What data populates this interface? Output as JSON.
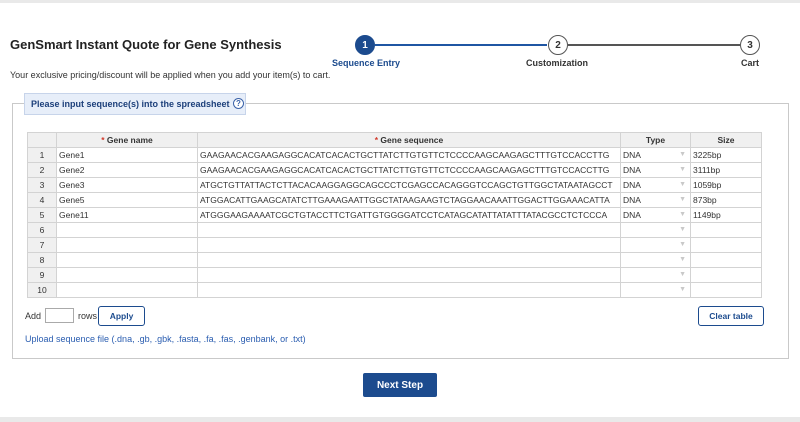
{
  "title": "GenSmart Instant Quote for Gene Synthesis",
  "subtitle": "Your exclusive pricing/discount will be applied when you add your item(s) to cart.",
  "steps": [
    {
      "num": "1",
      "label": "Sequence Entry",
      "active": true
    },
    {
      "num": "2",
      "label": "Customization",
      "active": false
    },
    {
      "num": "3",
      "label": "Cart",
      "active": false
    }
  ],
  "panel": {
    "tab_label": "Please input sequence(s) into the spreadsheet",
    "help_icon": "?"
  },
  "table": {
    "required_mark": "*",
    "headers": {
      "name": "Gene name",
      "sequence": "Gene sequence",
      "type": "Type",
      "size": "Size"
    },
    "rows": [
      {
        "n": "1",
        "name": "Gene1",
        "sequence": "GAAGAACACGAAGAGGCACATCACACTGCTTATCTTGTGTTCTCCCCAAGCAAGAGCTTTGTCCACCTTG",
        "type": "DNA",
        "size": "3225bp"
      },
      {
        "n": "2",
        "name": "Gene2",
        "sequence": "GAAGAACACGAAGAGGCACATCACACTGCTTATCTTGTGTTCTCCCCAAGCAAGAGCTTTGTCCACCTTG",
        "type": "DNA",
        "size": "3111bp"
      },
      {
        "n": "3",
        "name": "Gene3",
        "sequence": "ATGCTGTTATTACTCTTACACAAGGAGGCAGCCCTCGAGCCACAGGGTCCAGCTGTTGGCTATAATAGCCT",
        "type": "DNA",
        "size": "1059bp"
      },
      {
        "n": "4",
        "name": "Gene5",
        "sequence": "ATGGACATTGAAGCATATCTTGAAAGAATTGGCTATAAGAAGTCTAGGAACAAATTGGACTTGGAAACATTA",
        "type": "DNA",
        "size": "873bp"
      },
      {
        "n": "5",
        "name": "Gene11",
        "sequence": "ATGGGAAGAAAATCGCTGTACCTTCTGATTGTGGGGATCCTCATAGCATATTATATTTATACGCCTCTCCCA",
        "type": "DNA",
        "size": "1149bp"
      },
      {
        "n": "6",
        "name": "",
        "sequence": "",
        "type": "",
        "size": ""
      },
      {
        "n": "7",
        "name": "",
        "sequence": "",
        "type": "",
        "size": ""
      },
      {
        "n": "8",
        "name": "",
        "sequence": "",
        "type": "",
        "size": ""
      },
      {
        "n": "9",
        "name": "",
        "sequence": "",
        "type": "",
        "size": ""
      },
      {
        "n": "10",
        "name": "",
        "sequence": "",
        "type": "",
        "size": ""
      }
    ]
  },
  "controls": {
    "add_label": "Add",
    "rows_label": "rows",
    "rows_value": "",
    "apply_label": "Apply",
    "clear_label": "Clear table",
    "upload_label": "Upload sequence file (.dna, .gb, .gbk, .fasta, .fa, .fas, .genbank, or .txt)",
    "next_label": "Next Step"
  },
  "colors": {
    "accent": "#1c4b8e",
    "required": "#d23a2c",
    "link": "#2a5db0"
  },
  "icons": {
    "help": "question-circle-icon",
    "dropdown": "chevron-down-icon"
  }
}
